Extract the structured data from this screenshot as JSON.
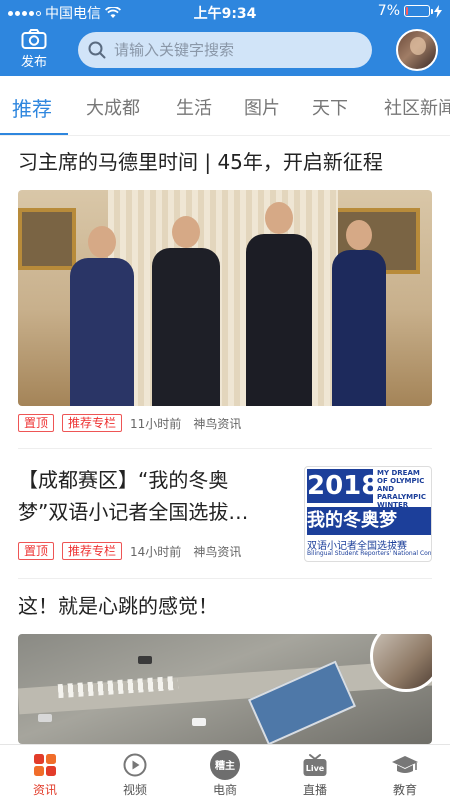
{
  "status_bar": {
    "carrier": "中国电信",
    "time": "上午9:34",
    "battery_text": "7%",
    "battery_level": 0.07
  },
  "header": {
    "publish_label": "发布",
    "search_placeholder": "请输入关键字搜索"
  },
  "tabs": [
    {
      "label": "推荐",
      "active": true
    },
    {
      "label": "大成都"
    },
    {
      "label": "生活"
    },
    {
      "label": "图片"
    },
    {
      "label": "天下"
    },
    {
      "label": "社区新闻"
    }
  ],
  "articles": [
    {
      "title": "习主席的马德里时间 | 45年，开启新征程",
      "tags": [
        "置顶",
        "推荐专栏"
      ],
      "time": "11小时前",
      "source": "神鸟资讯"
    },
    {
      "title_line1": "【成都赛区】“我的冬奥",
      "title_line2": "梦”双语小记者全国选拔…",
      "tags": [
        "置顶",
        "推荐专栏"
      ],
      "time": "14小时前",
      "source": "神鸟资讯",
      "thumb": {
        "year": "2018",
        "english": "MY DREAM OF OLYMPIC AND PARALYMPIC WINTER GAMES",
        "chinese": "我的冬奥梦",
        "sub": "双语小记者全国选拔赛",
        "sub_en": "Bilingual Student Reporters' National Contest"
      }
    },
    {
      "title": "这！就是心跳的感觉！"
    }
  ],
  "bottom_nav": [
    {
      "label": "资讯",
      "icon": "news-grid-icon",
      "active": true
    },
    {
      "label": "视频",
      "icon": "play-icon"
    },
    {
      "label": "电商",
      "icon": "shop-badge-icon",
      "badge_text": "糟主"
    },
    {
      "label": "直播",
      "icon": "tv-live-icon",
      "badge_text": "Live"
    },
    {
      "label": "教育",
      "icon": "graduation-cap-icon"
    }
  ],
  "colors": {
    "brand_blue": "#2e86de",
    "accent_red": "#e23c2a",
    "tag_red": "#e33333"
  }
}
